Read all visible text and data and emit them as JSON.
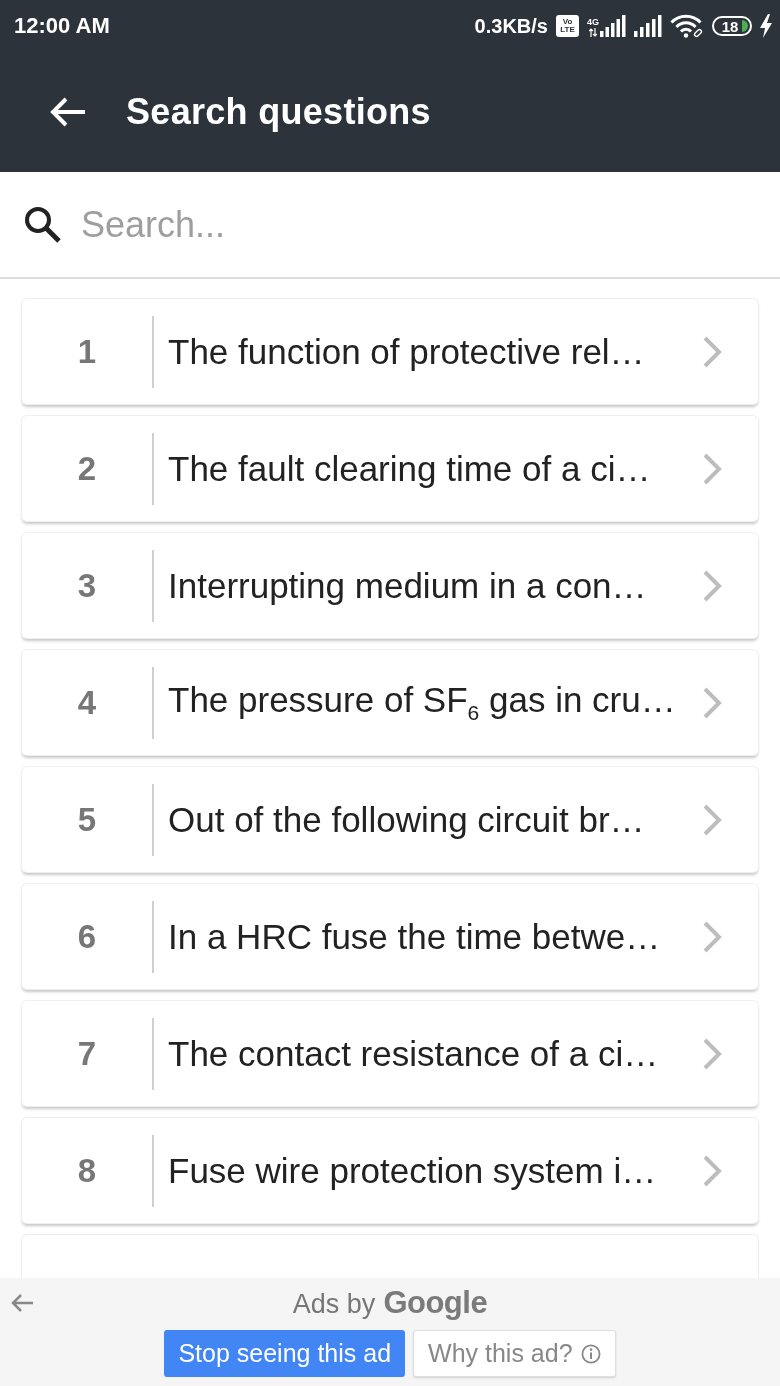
{
  "status_bar": {
    "time": "12:00 AM",
    "network_speed": "0.3KB/s",
    "volte_badge": [
      "Vo",
      "LTE"
    ],
    "network_type": "4G",
    "battery": "18"
  },
  "app_bar": {
    "title": "Search questions"
  },
  "search": {
    "placeholder": "Search..."
  },
  "questions": [
    {
      "number": "1",
      "text": "The function of protective rel…"
    },
    {
      "number": "2",
      "text": "The fault clearing time of a ci…"
    },
    {
      "number": "3",
      "text": "Interrupting medium in a con…"
    },
    {
      "number": "4",
      "text": "The pressure of SF$_{6}$ gas in cru…"
    },
    {
      "number": "5",
      "text": "Out of the following circuit br…"
    },
    {
      "number": "6",
      "text": "In a HRC fuse the time betwe…"
    },
    {
      "number": "7",
      "text": "The contact resistance of a ci…"
    },
    {
      "number": "8",
      "text": "Fuse wire protection system i…"
    }
  ],
  "ad_footer": {
    "label": "Ads by",
    "brand": "Google",
    "buttons": [
      {
        "label": "Stop seeing this ad",
        "kind": "primary"
      },
      {
        "label": "Why this ad?",
        "kind": "info"
      }
    ]
  }
}
